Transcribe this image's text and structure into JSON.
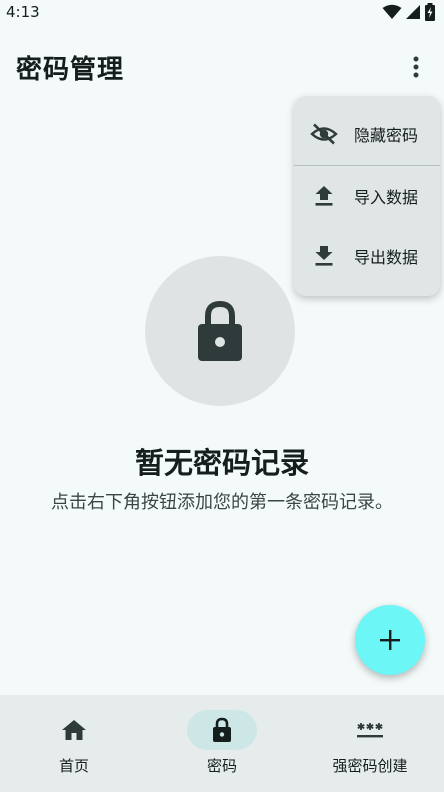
{
  "status_bar": {
    "time": "4:13",
    "icons": [
      "wifi-icon",
      "signal-icon",
      "battery-icon"
    ]
  },
  "app_bar": {
    "title": "密码管理",
    "more_icon": "more-vert-icon"
  },
  "menu": {
    "items": [
      {
        "label": "隐藏密码",
        "icon": "visibility-off-icon"
      },
      {
        "label": "导入数据",
        "icon": "upload-icon"
      },
      {
        "label": "导出数据",
        "icon": "download-icon"
      }
    ]
  },
  "empty_state": {
    "icon": "lock-icon",
    "title": "暂无密码记录",
    "description": "点击右下角按钮添加您的第一条密码记录。"
  },
  "fab": {
    "icon": "add-icon"
  },
  "bottom_nav": {
    "items": [
      {
        "label": "首页",
        "icon": "home-icon",
        "active": false
      },
      {
        "label": "密码",
        "icon": "lock-icon",
        "active": true
      },
      {
        "label": "强密码创建",
        "icon": "password-icon",
        "active": false
      }
    ]
  },
  "colors": {
    "background": "#f4fafa",
    "menu_background": "#e0e5e5",
    "fab": "#6cf6f6",
    "nav_background": "#e6ecec",
    "nav_active_indicator": "#cde7e7",
    "icon": "#2f3a3a"
  }
}
